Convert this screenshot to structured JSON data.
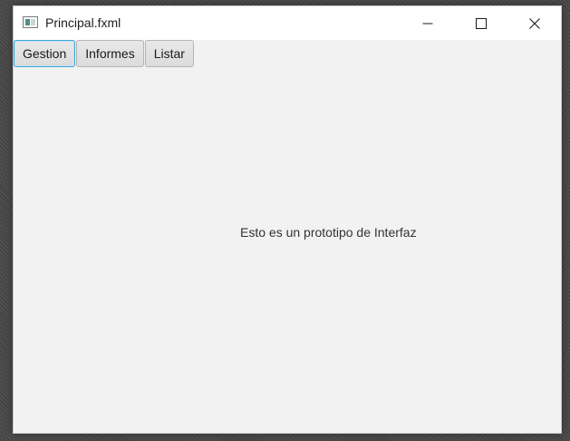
{
  "window": {
    "title": "Principal.fxml",
    "controls": {
      "minimize_icon": "minimize-icon",
      "maximize_icon": "maximize-icon",
      "close_icon": "close-icon"
    }
  },
  "toolbar": {
    "buttons": [
      {
        "label": "Gestion",
        "focused": true
      },
      {
        "label": "Informes",
        "focused": false
      },
      {
        "label": "Listar",
        "focused": false
      }
    ]
  },
  "main": {
    "message": "Esto es un prototipo de Interfaz"
  },
  "colors": {
    "focus_border": "#3fa6d8",
    "window_background": "#f2f2f2",
    "titlebar_background": "#ffffff"
  }
}
